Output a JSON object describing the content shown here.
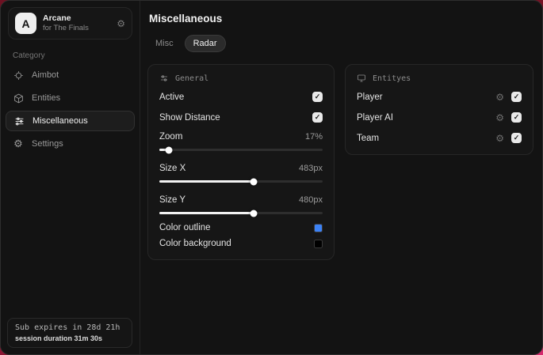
{
  "icons": {
    "gear_glyph": "⚙"
  },
  "colors": {
    "accent_blue": "#3c82f6",
    "swatch_black": "#000000"
  },
  "sidebar": {
    "logo_letter": "A",
    "app_title": "Arcane",
    "app_subtitle": "for The Finals",
    "category_label": "Category",
    "items": [
      {
        "label": "Aimbot",
        "icon": "crosshair-icon",
        "active": false
      },
      {
        "label": "Entities",
        "icon": "cube-icon",
        "active": false
      },
      {
        "label": "Miscellaneous",
        "icon": "sliders-icon",
        "active": true
      },
      {
        "label": "Settings",
        "icon": "gear-icon",
        "active": false
      }
    ],
    "footer": {
      "line1": "Sub expires in 28d 21h",
      "line2": "session duration 31m 30s"
    }
  },
  "main": {
    "title": "Miscellaneous",
    "tabs": [
      {
        "label": "Misc",
        "active": false
      },
      {
        "label": "Radar",
        "active": true
      }
    ]
  },
  "general": {
    "header": "General",
    "active": {
      "label": "Active",
      "checked": true
    },
    "show_distance": {
      "label": "Show Distance",
      "checked": true
    },
    "zoom": {
      "label": "Zoom",
      "value": "17%",
      "percent": 6
    },
    "size_x": {
      "label": "Size X",
      "value": "483px",
      "percent": 58
    },
    "size_y": {
      "label": "Size Y",
      "value": "480px",
      "percent": 58
    },
    "color_outline": {
      "label": "Color outline",
      "color": "#3c82f6"
    },
    "color_background": {
      "label": "Color background",
      "color": "#000000"
    }
  },
  "entities_panel": {
    "header": "Entityes",
    "rows": [
      {
        "label": "Player",
        "checked": true
      },
      {
        "label": "Player AI",
        "checked": true
      },
      {
        "label": "Team",
        "checked": true
      }
    ]
  }
}
